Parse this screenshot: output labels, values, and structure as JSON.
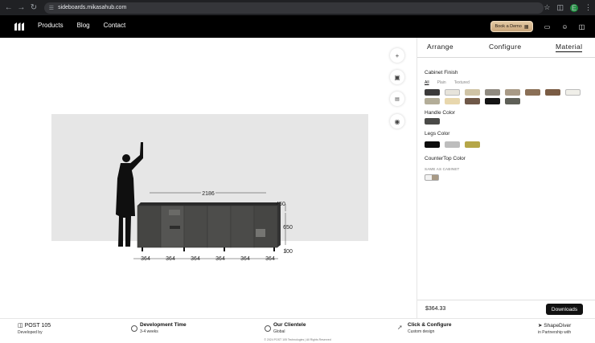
{
  "browser": {
    "url": "sideboards.mikasahub.com",
    "profile_initial": "E"
  },
  "header": {
    "nav": [
      "Products",
      "Blog",
      "Contact"
    ],
    "demo_button": "Book a Demo"
  },
  "panel": {
    "tabs": [
      "Arrange",
      "Configure",
      "Material"
    ],
    "active_tab": "Material",
    "cabinet_finish": {
      "title": "Cabinet Finish",
      "subtabs": [
        "All",
        "Plain",
        "Textured"
      ],
      "swatches": [
        "#3b3a3a",
        "#e7e4db",
        "#cfc3a5",
        "#8f8a80",
        "#a89a86",
        "#8a6f56",
        "#7a5c44",
        "#f0efe9",
        "#b3ad98",
        "#e8d7ad",
        "#6f5848",
        "#141414",
        "#5e5f57"
      ]
    },
    "handle_color": {
      "title": "Handle Color",
      "swatches": [
        "#4a4a48"
      ]
    },
    "legs_color": {
      "title": "Legs Color",
      "swatches": [
        "#0d0d0d",
        "#bdbdbd",
        "#b5a648"
      ]
    },
    "countertop_color": {
      "title": "CounterTop Color",
      "note": "SAME AS CABINET"
    },
    "price": "$364.33",
    "downloads_label": "Downloads"
  },
  "viewer": {
    "dims": {
      "width": "2186",
      "depth": "450",
      "height": "650",
      "legs": "100",
      "modules": [
        "364",
        "364",
        "364",
        "364",
        "364",
        "364"
      ]
    }
  },
  "footer": {
    "post": {
      "brand": "POST 105",
      "sub": "Developed by"
    },
    "dev_time": {
      "title": "Development Time",
      "sub": "3-4 weeks"
    },
    "clientele": {
      "title": "Our Clientele",
      "sub": "Global"
    },
    "click": {
      "title": "Click & Configure",
      "sub": "Custom design"
    },
    "shapediver": {
      "brand": "ShapeDiver",
      "sub": "in Partnership with"
    },
    "copyright": "© 2024 POST 105 Technologies | All Rights Reserved"
  }
}
